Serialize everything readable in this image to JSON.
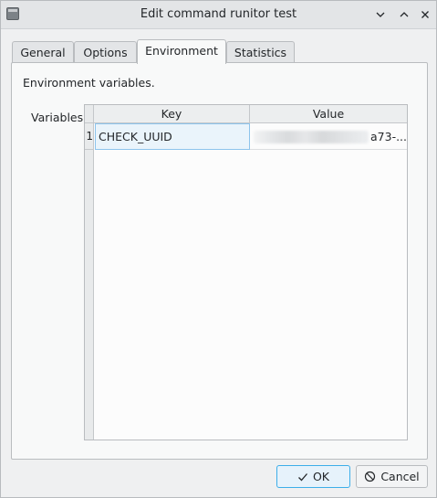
{
  "window": {
    "title": "Edit command runitor test",
    "icons": {
      "app": "terminal-icon",
      "minimize": "chevron-down-icon",
      "maximize": "chevron-up-icon",
      "close": "close-icon"
    }
  },
  "tabs": [
    {
      "label": "General"
    },
    {
      "label": "Options"
    },
    {
      "label": "Environment",
      "active": true
    },
    {
      "label": "Statistics"
    }
  ],
  "environment": {
    "description": "Environment variables.",
    "variables_label": "Variables",
    "table": {
      "columns": [
        "Key",
        "Value"
      ],
      "rows": [
        {
          "num": "1",
          "key": "CHECK_UUID",
          "value_visible": "a73-..."
        }
      ]
    }
  },
  "buttons": {
    "ok_label": "OK",
    "cancel_label": "Cancel",
    "ok_icon": "checkmark-icon",
    "cancel_icon": "cancel-icon"
  },
  "colors": {
    "accent": "#3daee9",
    "selected_cell": "#eaf4fb"
  }
}
